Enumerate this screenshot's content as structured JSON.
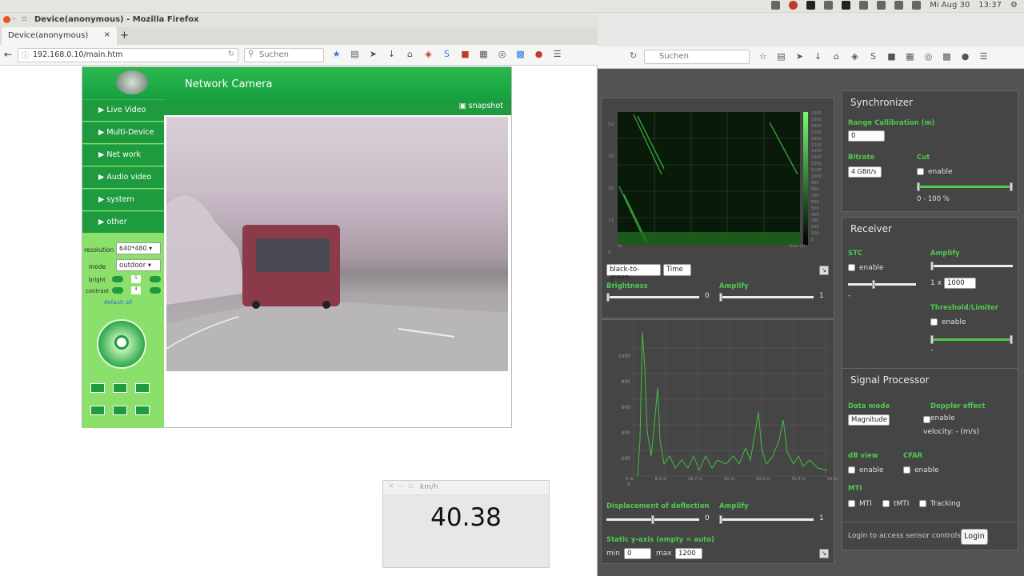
{
  "topbar": {
    "date": "Mi Aug 30",
    "time": "13:37"
  },
  "firefox": {
    "title": "Device(anonymous) - Mozilla Firefox",
    "tab_title": "Device(anonymous)",
    "url": "192.168.0.10/main.htm",
    "search_placeholder": "Suchen"
  },
  "camera": {
    "brand": "Network Camera",
    "snapshot_label": "snapshot",
    "menu": [
      "Live Video",
      "Multi-Device",
      "Net work",
      "Audio video",
      "system",
      "other"
    ],
    "resolution_label": "resolution",
    "resolution_value": "640*480",
    "mode_label": "mode",
    "mode_value": "outdoor",
    "bright_label": "bright",
    "bright_value": "5",
    "contrast_label": "contrast",
    "contrast_value": "4",
    "default_all": "default all"
  },
  "speed": {
    "title": "km/h",
    "value": "40.38"
  },
  "radar": {
    "spectro_y_ticks": [
      "52",
      "39",
      "26",
      "13",
      "0"
    ],
    "spectro_x_label": "time (s)",
    "spectro_x_start": "0s",
    "colorbar_ticks": [
      "2000",
      "1900",
      "1800",
      "1700",
      "1600",
      "1500",
      "1400",
      "1300",
      "1200",
      "1100",
      "1000",
      "900",
      "800",
      "700",
      "600",
      "500",
      "400",
      "300",
      "200",
      "100",
      "0"
    ],
    "colormap_value": "black-to-green",
    "timeline_value": "Time",
    "brightness_label": "Brightness",
    "brightness_value": "0",
    "amplify_label": "Amplify",
    "amplify_value": "1",
    "spectrum_y_ticks": [
      "1000",
      "800",
      "600",
      "400",
      "200",
      "0"
    ],
    "spectrum_x_ticks": [
      "0 m",
      "8.3 m",
      "16.7 m",
      "25 m",
      "33.3 m",
      "41.6 m",
      "50 m"
    ],
    "displacement_label": "Displacement of deflection",
    "displacement_value": "0",
    "amplify2_label": "Amplify",
    "amplify2_value": "1",
    "static_y_label": "Static y-axis (empty = auto)",
    "min_label": "min",
    "min_value": "0",
    "max_label": "max",
    "max_value": "1200"
  },
  "sync": {
    "title": "Synchronizer",
    "range_label": "Range Callibration (m)",
    "range_value": "0",
    "bitrate_label": "Bitrate",
    "bitrate_value": "4 GBit/s",
    "cut_label": "Cut",
    "cut_enable": "enable",
    "cut_range": "0 - 100 %"
  },
  "receiver": {
    "title": "Receiver",
    "stc_label": "STC",
    "stc_enable": "enable",
    "stc_dash": "-",
    "amplify_label": "Amplify",
    "amplify_prefix": "1 x",
    "amplify_value": "1000",
    "threshold_label": "Threshold/Limiter",
    "threshold_enable": "enable",
    "threshold_dash": "-"
  },
  "signal": {
    "title": "Signal Processor",
    "data_mode_label": "Data mode",
    "data_mode_value": "Magnitude",
    "doppler_label": "Doppler effect",
    "doppler_enable": "enable",
    "velocity_text": "velocity: - (m/s)",
    "db_label": "dB view",
    "db_enable": "enable",
    "cfar_label": "CFAR",
    "cfar_enable": "enable",
    "mti_label": "MTI",
    "mti_opt1": "MTI",
    "mti_opt2": "tMTI",
    "mti_opt3": "Tracking"
  },
  "login": {
    "text": "Login to access sensor controls.",
    "button": "Login"
  },
  "colors": {
    "accent_green": "#4fc94f",
    "camera_green": "#1e9a3f",
    "panel_bg": "#454545"
  }
}
